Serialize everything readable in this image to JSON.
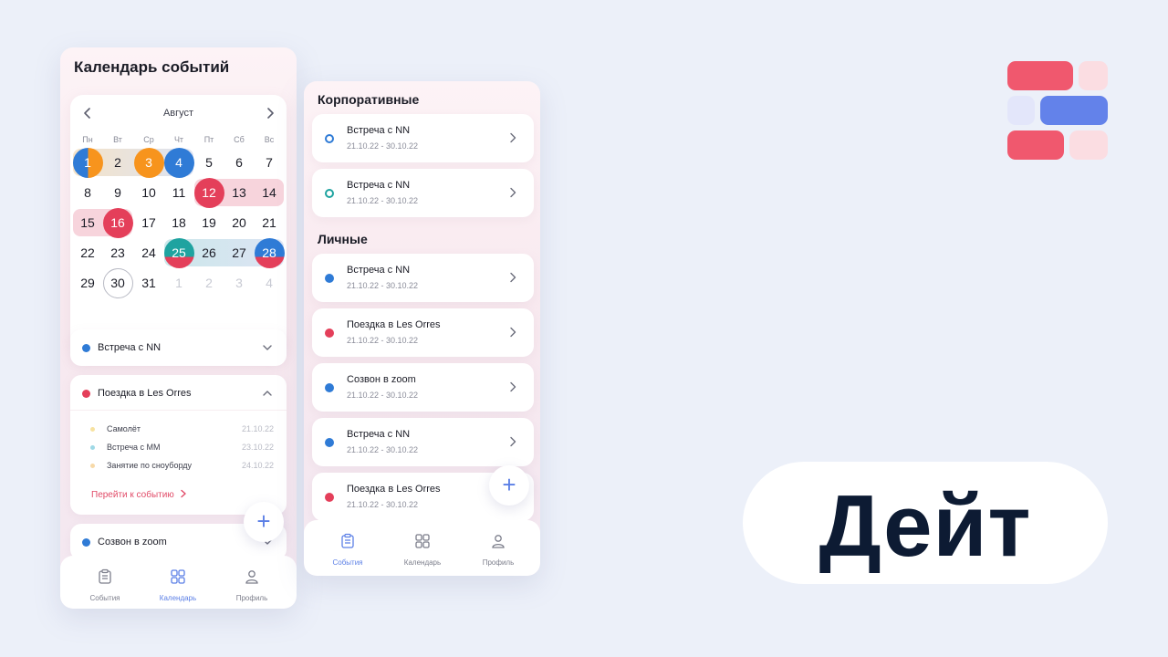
{
  "calendar_screen": {
    "title": "Календарь событий",
    "month": "Август",
    "weekdays": [
      "Пн",
      "Вт",
      "Ср",
      "Чт",
      "Пт",
      "Сб",
      "Вс"
    ],
    "weeks": [
      [
        "1",
        "2",
        "3",
        "4",
        "5",
        "6",
        "7"
      ],
      [
        "8",
        "9",
        "10",
        "11",
        "12",
        "13",
        "14"
      ],
      [
        "15",
        "16",
        "17",
        "18",
        "19",
        "20",
        "21"
      ],
      [
        "22",
        "23",
        "24",
        "25",
        "26",
        "27",
        "28"
      ],
      [
        "29",
        "30",
        "31",
        "1",
        "2",
        "3",
        "4"
      ]
    ],
    "events": [
      {
        "title": "Встреча с NN",
        "color": "#2f7bd6"
      },
      {
        "title": "Поездка в Les Orres",
        "color": "#e43f5a"
      },
      {
        "title": "Созвон в zoom",
        "color": "#2f7bd6"
      }
    ],
    "expanded_items": [
      {
        "label": "Самолёт",
        "date": "21.10.22",
        "color": "#f7e2a0"
      },
      {
        "label": "Встреча с ММ",
        "date": "23.10.22",
        "color": "#9fd9e6"
      },
      {
        "label": "Занятие по сноуборду",
        "date": "24.10.22",
        "color": "#f7d9a8"
      }
    ],
    "goto_link": "Перейти к событию",
    "fab_label": "+",
    "tabs": [
      {
        "label": "События",
        "icon": "clipboard-icon",
        "active": false
      },
      {
        "label": "Календарь",
        "icon": "grid-icon",
        "active": true
      },
      {
        "label": "Профиль",
        "icon": "person-icon",
        "active": false
      }
    ]
  },
  "events_screen": {
    "section_corporate": "Корпоративные",
    "section_personal": "Личные",
    "corporate_events": [
      {
        "title": "Встреча с NN",
        "dates": "21.10.22 - 30.10.22",
        "color": "#2f7bd6",
        "style": "ring"
      },
      {
        "title": "Встреча с NN",
        "dates": "21.10.22 - 30.10.22",
        "color": "#1fa3a0",
        "style": "ring"
      }
    ],
    "personal_events": [
      {
        "title": "Встреча с NN",
        "dates": "21.10.22 - 30.10.22",
        "color": "#2f7bd6",
        "style": "dot"
      },
      {
        "title": "Поездка в Les Orres",
        "dates": "21.10.22 - 30.10.22",
        "color": "#e43f5a",
        "style": "dot"
      },
      {
        "title": "Созвон в zoom",
        "dates": "21.10.22 - 30.10.22",
        "color": "#2f7bd6",
        "style": "dot"
      },
      {
        "title": "Встреча с NN",
        "dates": "21.10.22 - 30.10.22",
        "color": "#2f7bd6",
        "style": "dot"
      },
      {
        "title": "Поездка в Les Orres",
        "dates": "21.10.22 - 30.10.22",
        "color": "#e43f5a",
        "style": "dot"
      }
    ],
    "fab_label": "+",
    "tabs": [
      {
        "label": "События",
        "icon": "clipboard-icon",
        "active": true
      },
      {
        "label": "Календарь",
        "icon": "grid-icon",
        "active": false
      },
      {
        "label": "Профиль",
        "icon": "person-icon",
        "active": false
      }
    ]
  },
  "brand": {
    "wordmark": "Дейт",
    "colors": {
      "red": "#f0586e",
      "blue": "#6382ea",
      "pink": "#fbdde2",
      "lavender": "#e3e6fa",
      "ink": "#0d1b33"
    }
  }
}
